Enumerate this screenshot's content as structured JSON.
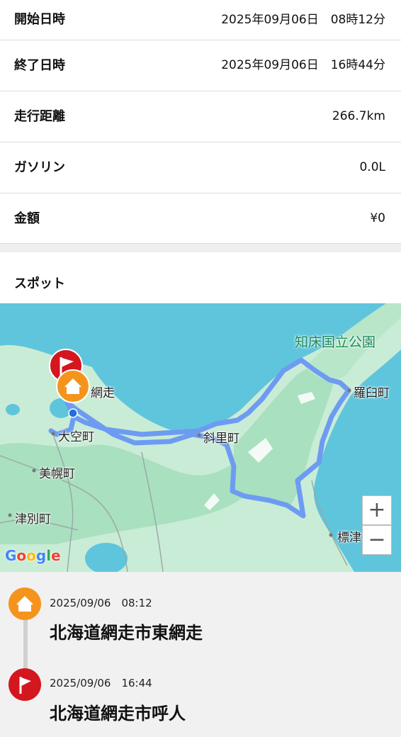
{
  "details": {
    "start": {
      "label": "開始日時",
      "value": "2025年09月06日　08時12分"
    },
    "end": {
      "label": "終了日時",
      "value": "2025年09月06日　16時44分"
    },
    "distance": {
      "label": "走行距離",
      "value": "266.7km"
    },
    "gasoline": {
      "label": "ガソリン",
      "value": "0.0L"
    },
    "amount": {
      "label": "金額",
      "value": "¥0"
    }
  },
  "spots": {
    "title": "スポット"
  },
  "map": {
    "places": {
      "abashiri": "網走",
      "ozora": "大空町",
      "bihoro": "美幌町",
      "tsubetsu": "津別町",
      "shari": "斜里町",
      "rausu": "羅臼町",
      "shibetsu": "標津",
      "park": "知床国立公園"
    },
    "zoom_in": "+",
    "zoom_out": "−",
    "attribution": "Google",
    "route_color": "#6e9bf2",
    "water_color": "#5fc5dc"
  },
  "timeline": [
    {
      "icon": "home-icon",
      "color": "#f5941d",
      "datetime": "2025/09/06　08:12",
      "address": "北海道網走市東網走"
    },
    {
      "icon": "flag-icon",
      "color": "#d4161e",
      "datetime": "2025/09/06　16:44",
      "address": "北海道網走市呼人"
    }
  ]
}
